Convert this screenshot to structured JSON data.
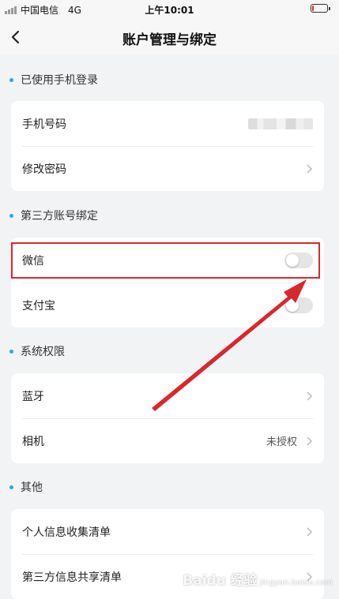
{
  "status_bar": {
    "carrier": "中国电信",
    "network": "4G",
    "time": "上午10:01",
    "battery_level": 0.1,
    "battery_color": "#e03030"
  },
  "nav": {
    "back_icon": "chevron-left-icon",
    "title": "账户管理与绑定"
  },
  "sections": {
    "phone_login": {
      "title": "已使用手机登录",
      "rows": {
        "phone": {
          "label": "手机号码",
          "value_blurred": true
        },
        "password": {
          "label": "修改密码"
        }
      }
    },
    "third_party": {
      "title": "第三方账号绑定",
      "rows": {
        "wechat": {
          "label": "微信",
          "toggle_on": false
        },
        "alipay": {
          "label": "支付宝",
          "toggle_on": false
        }
      }
    },
    "permissions": {
      "title": "系统权限",
      "rows": {
        "bluetooth": {
          "label": "蓝牙"
        },
        "camera": {
          "label": "相机",
          "value": "未授权"
        }
      }
    },
    "other": {
      "title": "其他",
      "rows": {
        "personal_info": {
          "label": "个人信息收集清单"
        },
        "third_party_share": {
          "label": "第三方信息共享清单"
        }
      }
    }
  },
  "annotation": {
    "highlight_color": "#d9282d",
    "arrow_color": "#d9282d"
  },
  "watermark": {
    "text": "Baidu 经验",
    "sub": "jingyan.baidu.com"
  },
  "accent_color": "#2ba7e8"
}
